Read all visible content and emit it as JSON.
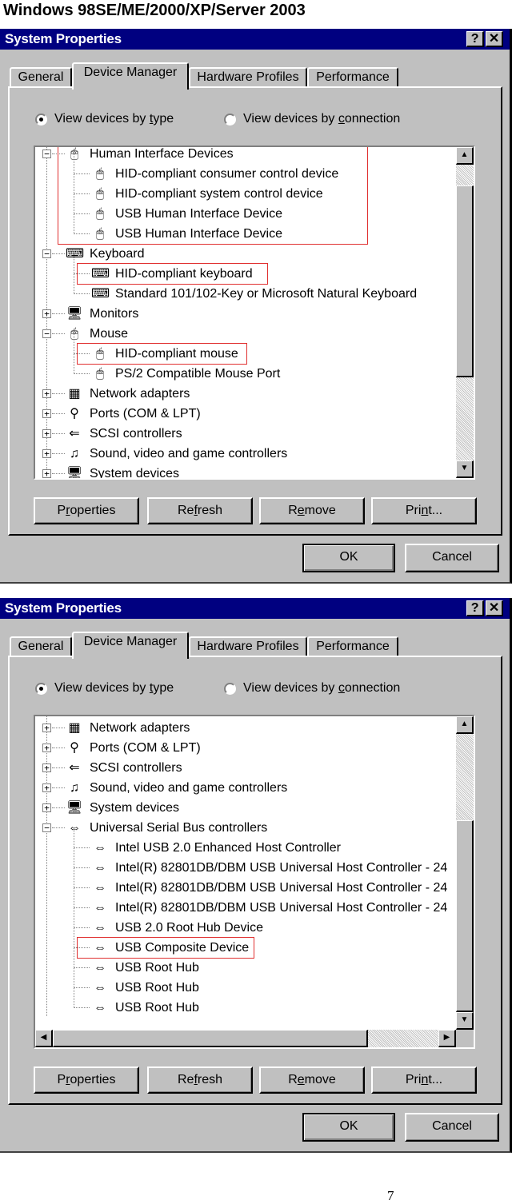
{
  "heading": "Windows 98SE/ME/2000/XP/Server 2003",
  "page_number": "7",
  "dialogs": [
    {
      "title": "System Properties",
      "title_buttons": {
        "help": "?",
        "close": "✕"
      },
      "tabs": [
        {
          "label": "General",
          "active": false
        },
        {
          "label": "Device Manager",
          "active": true
        },
        {
          "label": "Hardware Profiles",
          "active": false
        },
        {
          "label": "Performance",
          "active": false
        }
      ],
      "radios": [
        {
          "label_pre": "View devices by ",
          "label_ul": "t",
          "label_post": "ype",
          "checked": true
        },
        {
          "label_pre": "View devices by ",
          "label_ul": "c",
          "label_post": "onnection",
          "checked": false
        }
      ],
      "tree": [
        {
          "level": 0,
          "expander": "−",
          "icon": "hid-icon",
          "glyph": "🖱",
          "label": "Human Interface Devices"
        },
        {
          "level": 1,
          "icon": "hid-icon",
          "glyph": "🖱",
          "label": "HID-compliant consumer control device"
        },
        {
          "level": 1,
          "icon": "hid-icon",
          "glyph": "🖱",
          "label": "HID-compliant system control device"
        },
        {
          "level": 1,
          "icon": "hid-icon",
          "glyph": "🖱",
          "label": "USB Human Interface Device"
        },
        {
          "level": 1,
          "icon": "hid-icon",
          "glyph": "🖱",
          "label": "USB Human Interface Device"
        },
        {
          "level": 0,
          "expander": "−",
          "icon": "keyboard-icon",
          "glyph": "⌨",
          "label": "Keyboard"
        },
        {
          "level": 1,
          "icon": "keyboard-icon",
          "glyph": "⌨",
          "label": "HID-compliant keyboard"
        },
        {
          "level": 1,
          "icon": "keyboard-icon",
          "glyph": "⌨",
          "label": "Standard 101/102-Key or Microsoft Natural Keyboard"
        },
        {
          "level": 0,
          "expander": "+",
          "icon": "monitor-icon",
          "glyph": "🖥",
          "label": "Monitors"
        },
        {
          "level": 0,
          "expander": "−",
          "icon": "mouse-icon",
          "glyph": "🖱",
          "label": "Mouse"
        },
        {
          "level": 1,
          "icon": "mouse-icon",
          "glyph": "🖱",
          "label": "HID-compliant mouse"
        },
        {
          "level": 1,
          "icon": "mouse-icon",
          "glyph": "🖱",
          "label": "PS/2 Compatible Mouse Port"
        },
        {
          "level": 0,
          "expander": "+",
          "icon": "network-adapter-icon",
          "glyph": "▦",
          "label": "Network adapters"
        },
        {
          "level": 0,
          "expander": "+",
          "icon": "port-icon",
          "glyph": "⚲",
          "label": "Ports (COM & LPT)"
        },
        {
          "level": 0,
          "expander": "+",
          "icon": "scsi-icon",
          "glyph": "⇐",
          "label": "SCSI controllers"
        },
        {
          "level": 0,
          "expander": "+",
          "icon": "sound-icon",
          "glyph": "♫",
          "label": "Sound, video and game controllers"
        },
        {
          "level": 0,
          "expander": "+",
          "icon": "system-device-icon",
          "glyph": "🖥",
          "label": "System devices"
        }
      ],
      "highlights": [
        {
          "rows": [
            0,
            4
          ],
          "label": "Human Interface Devices group"
        },
        {
          "rows": [
            6,
            6
          ],
          "label": "HID-compliant keyboard"
        },
        {
          "rows": [
            10,
            10
          ],
          "label": "HID-compliant mouse"
        }
      ],
      "scroll": {
        "vertical_position_fraction": 0.2,
        "has_horizontal": false
      },
      "buttons": [
        {
          "pre": "P",
          "ul": "r",
          "post": "operties"
        },
        {
          "pre": "Re",
          "ul": "f",
          "post": "resh"
        },
        {
          "pre": "R",
          "ul": "e",
          "post": "move"
        },
        {
          "pre": "Pri",
          "ul": "n",
          "post": "t..."
        }
      ],
      "ok_label": "OK",
      "cancel_label": "Cancel"
    },
    {
      "title": "System Properties",
      "title_buttons": {
        "help": "?",
        "close": "✕"
      },
      "tabs": [
        {
          "label": "General",
          "active": false
        },
        {
          "label": "Device Manager",
          "active": true
        },
        {
          "label": "Hardware Profiles",
          "active": false
        },
        {
          "label": "Performance",
          "active": false
        }
      ],
      "radios": [
        {
          "label_pre": "View devices by ",
          "label_ul": "t",
          "label_post": "ype",
          "checked": true
        },
        {
          "label_pre": "View devices by ",
          "label_ul": "c",
          "label_post": "onnection",
          "checked": false
        }
      ],
      "tree": [
        {
          "level": 0,
          "expander": "+",
          "icon": "network-adapter-icon",
          "glyph": "▦",
          "label": "Network adapters"
        },
        {
          "level": 0,
          "expander": "+",
          "icon": "port-icon",
          "glyph": "⚲",
          "label": "Ports (COM & LPT)"
        },
        {
          "level": 0,
          "expander": "+",
          "icon": "scsi-icon",
          "glyph": "⇐",
          "label": "SCSI controllers"
        },
        {
          "level": 0,
          "expander": "+",
          "icon": "sound-icon",
          "glyph": "♫",
          "label": "Sound, video and game controllers"
        },
        {
          "level": 0,
          "expander": "+",
          "icon": "system-device-icon",
          "glyph": "🖥",
          "label": "System devices"
        },
        {
          "level": 0,
          "expander": "−",
          "icon": "usb-icon",
          "glyph": "⇔",
          "label": "Universal Serial Bus controllers"
        },
        {
          "level": 1,
          "icon": "usb-icon",
          "glyph": "⇔",
          "label": "Intel USB 2.0 Enhanced Host Controller"
        },
        {
          "level": 1,
          "icon": "usb-icon",
          "glyph": "⇔",
          "label": "Intel(R) 82801DB/DBM USB Universal Host Controller - 24"
        },
        {
          "level": 1,
          "icon": "usb-icon",
          "glyph": "⇔",
          "label": "Intel(R) 82801DB/DBM USB Universal Host Controller - 24"
        },
        {
          "level": 1,
          "icon": "usb-icon",
          "glyph": "⇔",
          "label": "Intel(R) 82801DB/DBM USB Universal Host Controller - 24"
        },
        {
          "level": 1,
          "icon": "usb-icon",
          "glyph": "⇔",
          "label": "USB 2.0 Root Hub Device"
        },
        {
          "level": 1,
          "icon": "usb-icon",
          "glyph": "⇔",
          "label": "USB Composite Device"
        },
        {
          "level": 1,
          "icon": "usb-icon",
          "glyph": "⇔",
          "label": "USB Root Hub"
        },
        {
          "level": 1,
          "icon": "usb-icon",
          "glyph": "⇔",
          "label": "USB Root Hub"
        },
        {
          "level": 1,
          "icon": "usb-icon",
          "glyph": "⇔",
          "label": "USB Root Hub"
        }
      ],
      "highlights": [
        {
          "rows": [
            11,
            11
          ],
          "label": "USB Composite Device"
        }
      ],
      "scroll": {
        "vertical_position_fraction": 1.0,
        "has_horizontal": true
      },
      "buttons": [
        {
          "pre": "P",
          "ul": "r",
          "post": "operties"
        },
        {
          "pre": "Re",
          "ul": "f",
          "post": "resh"
        },
        {
          "pre": "R",
          "ul": "e",
          "post": "move"
        },
        {
          "pre": "Pri",
          "ul": "n",
          "post": "t..."
        }
      ],
      "ok_label": "OK",
      "cancel_label": "Cancel"
    }
  ]
}
